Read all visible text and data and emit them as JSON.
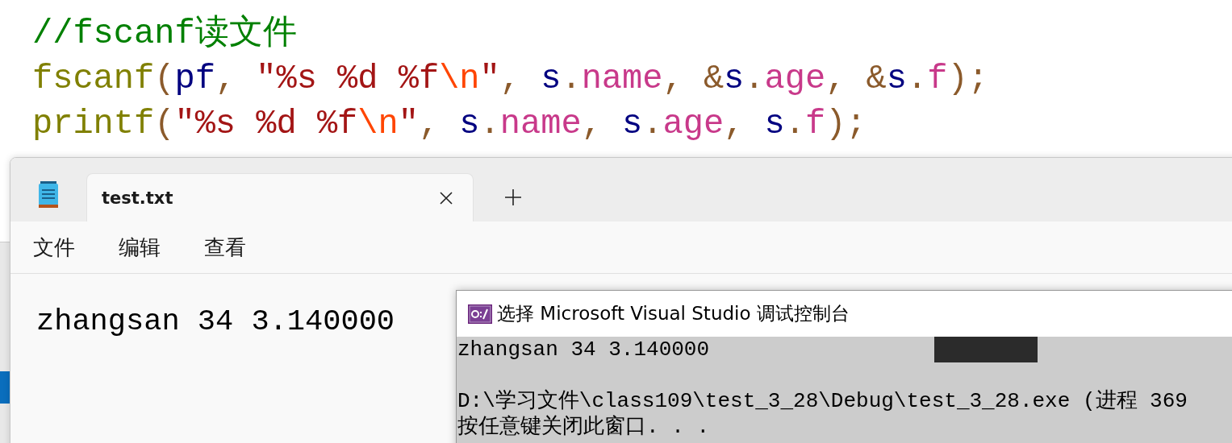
{
  "code_lines": [
    [
      {
        "t": "//fscanf读文件",
        "kind": "comment"
      }
    ],
    [
      {
        "t": "fscanf",
        "kind": "function"
      },
      {
        "t": "(",
        "kind": "punct"
      },
      {
        "t": "pf",
        "kind": "variable"
      },
      {
        "t": ", ",
        "kind": "punct"
      },
      {
        "t": "\"%s %d %f",
        "kind": "string"
      },
      {
        "t": "\\n",
        "kind": "escape"
      },
      {
        "t": "\"",
        "kind": "string"
      },
      {
        "t": ", ",
        "kind": "punct"
      },
      {
        "t": "s",
        "kind": "variable"
      },
      {
        "t": ".",
        "kind": "punct"
      },
      {
        "t": "name",
        "kind": "member"
      },
      {
        "t": ", &",
        "kind": "punct"
      },
      {
        "t": "s",
        "kind": "variable"
      },
      {
        "t": ".",
        "kind": "punct"
      },
      {
        "t": "age",
        "kind": "member"
      },
      {
        "t": ", &",
        "kind": "punct"
      },
      {
        "t": "s",
        "kind": "variable"
      },
      {
        "t": ".",
        "kind": "punct"
      },
      {
        "t": "f",
        "kind": "member"
      },
      {
        "t": ");",
        "kind": "punct"
      }
    ],
    [
      {
        "t": "printf",
        "kind": "function"
      },
      {
        "t": "(",
        "kind": "punct"
      },
      {
        "t": "\"%s %d %f",
        "kind": "string"
      },
      {
        "t": "\\n",
        "kind": "escape"
      },
      {
        "t": "\"",
        "kind": "string"
      },
      {
        "t": ", ",
        "kind": "punct"
      },
      {
        "t": "s",
        "kind": "variable"
      },
      {
        "t": ".",
        "kind": "punct"
      },
      {
        "t": "name",
        "kind": "member"
      },
      {
        "t": ", ",
        "kind": "punct"
      },
      {
        "t": "s",
        "kind": "variable"
      },
      {
        "t": ".",
        "kind": "punct"
      },
      {
        "t": "age",
        "kind": "member"
      },
      {
        "t": ", ",
        "kind": "punct"
      },
      {
        "t": "s",
        "kind": "variable"
      },
      {
        "t": ".",
        "kind": "punct"
      },
      {
        "t": "f",
        "kind": "member"
      },
      {
        "t": ");",
        "kind": "punct"
      }
    ]
  ],
  "notepad": {
    "tabs": [
      {
        "label": "test.txt",
        "selected": true
      }
    ],
    "menu": [
      "文件",
      "编辑",
      "查看"
    ],
    "content": "zhangsan 34 3.140000"
  },
  "console": {
    "title": "选择 Microsoft Visual Studio 调试控制台",
    "lines": [
      {
        "text": "zhangsan 34 3.140000",
        "blank_before": false
      },
      {
        "text": "D:\\学习文件\\class109\\test_3_28\\Debug\\test_3_28.exe (进程 369",
        "blank_before": true
      },
      {
        "text": "按任意键关闭此窗口. . .",
        "blank_before": false
      }
    ]
  }
}
